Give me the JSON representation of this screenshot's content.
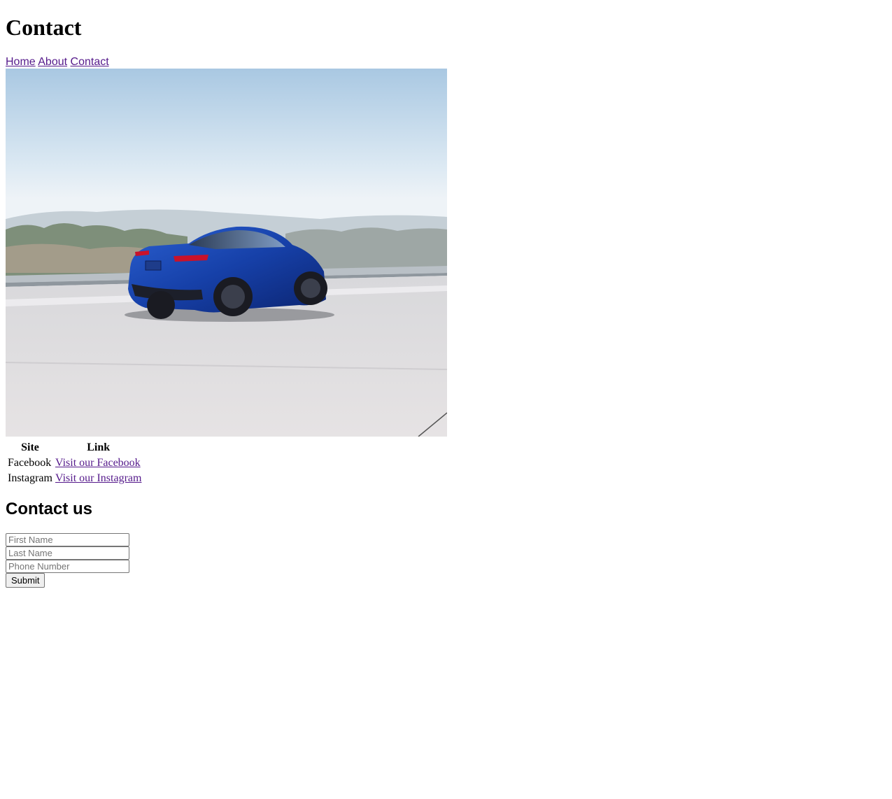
{
  "header": {
    "title": "Contact"
  },
  "nav": {
    "items": [
      {
        "label": "Home"
      },
      {
        "label": "About"
      },
      {
        "label": "Contact"
      }
    ]
  },
  "hero": {
    "description": "blue-car-on-highway-photo"
  },
  "social_table": {
    "headers": [
      "Site",
      "Link"
    ],
    "rows": [
      {
        "site": "Facebook",
        "link": "Visit our Facebook"
      },
      {
        "site": "Instagram",
        "link": "Visit our Instagram"
      }
    ]
  },
  "contact": {
    "heading": "Contact us",
    "first_name_placeholder": "First Name",
    "last_name_placeholder": "Last Name",
    "phone_placeholder": "Phone Number",
    "submit_label": "Submit"
  },
  "colors": {
    "link_visited": "#551a8b",
    "car_blue": "#1a3fa0"
  }
}
